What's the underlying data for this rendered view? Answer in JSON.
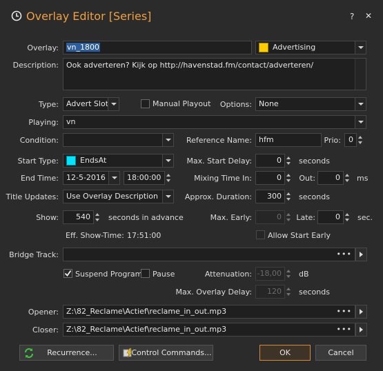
{
  "title": "Overlay Editor [Series]",
  "titlebar": {
    "help": "?",
    "close": "✕"
  },
  "labels": {
    "overlay": "Overlay:",
    "description": "Description:",
    "type": "Type:",
    "manual_playout": "Manual Playout",
    "options": "Options:",
    "playing": "Playing:",
    "condition": "Condition:",
    "reference_name": "Reference Name:",
    "prio": "Prio:",
    "start_type": "Start Type:",
    "max_start_delay": "Max. Start Delay:",
    "seconds": "seconds",
    "end_time": "End Time:",
    "mixing_time_in": "Mixing Time In:",
    "out": "Out:",
    "ms": "ms",
    "title_updates": "Title Updates:",
    "approx_duration": "Approx. Duration:",
    "show": "Show:",
    "seconds_in_advance": "seconds in advance",
    "max_early": "Max. Early:",
    "late": "Late:",
    "sec": "sec.",
    "eff_show_time": "Eff. Show-Time:",
    "allow_start_early": "Allow Start Early",
    "bridge_track": "Bridge Track:",
    "suspend_program": "Suspend Program",
    "pause": "Pause",
    "attenuation": "Attenuation:",
    "db": "dB",
    "max_overlay_delay": "Max. Overlay Delay:",
    "opener": "Opener:",
    "closer": "Closer:"
  },
  "values": {
    "overlay": "vn_1800",
    "category": "Advertising",
    "category_color": "#ffcc00",
    "description": "Ook adverteren? Kijk op http://havenstad.fm/contact/adverteren/",
    "type": "Advert Slot",
    "options": "None",
    "playing": "vn",
    "condition": "",
    "reference_name": "hfm",
    "prio": "0",
    "start_type": "EndsAt",
    "start_type_color": "#00e5ff",
    "max_start_delay": "0",
    "end_date": "12-5-2016",
    "end_time": "18:00:00",
    "mixing_time_in": "0",
    "out": "0",
    "title_updates": "Use Overlay Description",
    "approx_duration": "300",
    "show": "540",
    "max_early": "0",
    "late": "0",
    "eff_show_time": "17:51:00",
    "bridge_track": "",
    "attenuation": "-18,00",
    "max_overlay_delay": "120",
    "opener": "Z:\\82_Reclame\\Actief\\reclame_in_out.mp3",
    "closer": "Z:\\82_Reclame\\Actief\\reclame_in_out.mp3",
    "ellipsis": "•••"
  },
  "checks": {
    "manual_playout": false,
    "allow_start_early": false,
    "suspend_program": true,
    "pause": false
  },
  "buttons": {
    "recurrence": "Recurrence...",
    "control_commands": "Control Commands...",
    "ok": "OK",
    "cancel": "Cancel"
  },
  "colors": {
    "accent": "#f0a040",
    "background": "#2b2b2b",
    "ok_border": "#d88a3a"
  }
}
